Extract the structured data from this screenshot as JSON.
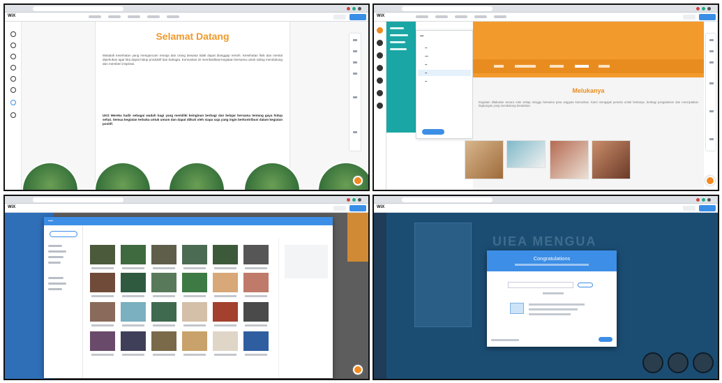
{
  "panel1": {
    "title": "Selamat Datang",
    "paragraph1": "Masalah kesehatan yang mengancam remaja dan orang dewasa tidak dapat dianggap remeh. Kesehatan fisik dan mental diperlukan agar kita dapat hidup produktif dan bahagia. Komunitas ini memfasilitasi kegiatan bersama untuk saling mendukung dan memberi inspirasi.",
    "paragraph2": "UKS Mereka hadir sebagai wadah bagi yang memiliki keinginan berbagi dan belajar bersama tentang gaya hidup sehat. Semua kegiatan terbuka untuk umum dan dapat diikuti oleh siapa saja yang ingin berkontribusi dalam kegiatan positif."
  },
  "panel2": {
    "heading": "Melukanya",
    "body": "Kegiatan dilakukan secara rutin setiap minggu bersama para anggota komunitas. Kami mengajak peserta untuk berkarya, berbagi pengalaman dan menciptakan lingkungan yang mendukung kreativitas."
  },
  "panel4": {
    "big_title": "UIEA MENGUA",
    "dialog_title": "Congratulations"
  }
}
